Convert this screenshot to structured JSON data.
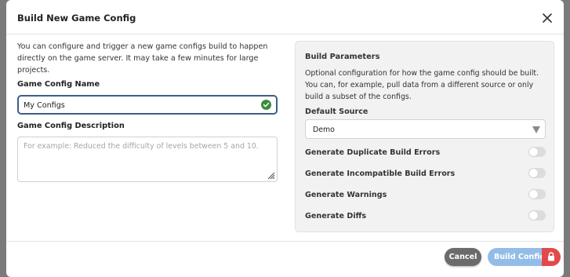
{
  "dialog": {
    "title": "Build New Game Config",
    "intro_text": "You can configure and trigger a new game configs build to happen directly on the game server. It may take a few minutes for large projects."
  },
  "form": {
    "name_label": "Game Config Name",
    "name_value": "My Configs",
    "name_valid": true,
    "description_label": "Game Config Description",
    "description_placeholder": "For example: Reduced the difficulty of levels between 5 and 10.",
    "description_value": ""
  },
  "build_parameters": {
    "title": "Build Parameters",
    "description": "Optional configuration for how the game config should be built. You can, for example, pull data from a different source or only build a subset of the configs.",
    "default_source_label": "Default Source",
    "default_source_value": "Demo",
    "toggles": [
      {
        "label": "Generate Duplicate Build Errors",
        "on": false
      },
      {
        "label": "Generate Incompatible Build Errors",
        "on": false
      },
      {
        "label": "Generate Warnings",
        "on": false
      },
      {
        "label": "Generate Diffs",
        "on": false
      }
    ]
  },
  "footer": {
    "cancel_label": "Cancel",
    "build_label": "Build Config"
  },
  "icons": {
    "close": "close-icon",
    "valid": "check-circle-icon",
    "resize": "resize-handle-icon",
    "dropdown": "chevron-down-icon",
    "lock": "lock-icon"
  },
  "colors": {
    "valid_green": "#3f8a3f",
    "input_focus_border": "#3c5f86",
    "cancel_bg": "#6b6b6b",
    "build_bg": "#93bde8",
    "lock_bg": "#e24a4a",
    "panel_bg": "#f2f2f2"
  }
}
